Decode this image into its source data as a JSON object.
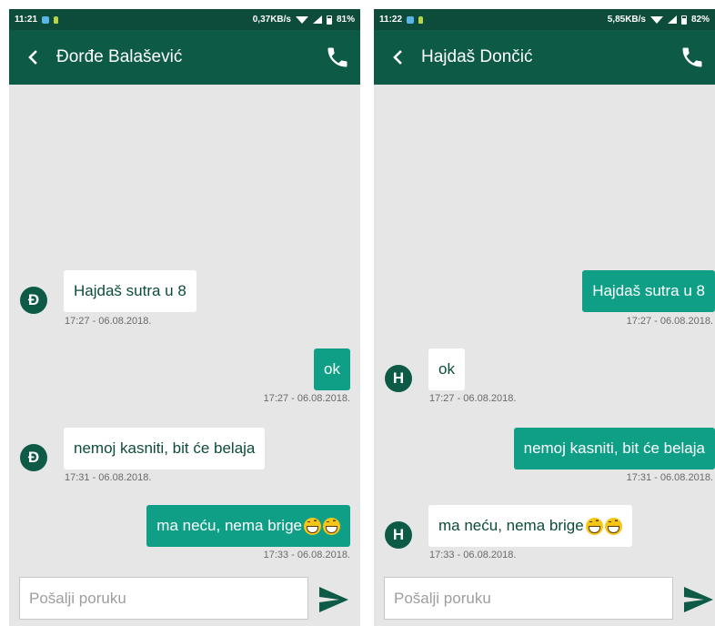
{
  "left_phone": {
    "status": {
      "time": "11:21",
      "net": "0,37KB/s",
      "battery": "81%"
    },
    "contact": {
      "name": "Đorđe Balašević",
      "initial": "Đ"
    },
    "messages": [
      {
        "dir": "in",
        "text": "Hajdaš sutra u 8",
        "emoji": 0,
        "time": "17:27 - 06.08.2018."
      },
      {
        "dir": "out",
        "text": "ok",
        "emoji": 0,
        "time": "17:27 - 06.08.2018."
      },
      {
        "dir": "in",
        "text": "nemoj kasniti, bit će belaja",
        "emoji": 0,
        "time": "17:31 - 06.08.2018."
      },
      {
        "dir": "out",
        "text": "ma neću, nema brige ",
        "emoji": 2,
        "time": "17:33 - 06.08.2018."
      }
    ],
    "composer": {
      "placeholder": "Pošalji poruku"
    }
  },
  "right_phone": {
    "status": {
      "time": "11:22",
      "net": "5,85KB/s",
      "battery": "82%"
    },
    "contact": {
      "name": "Hajdaš Dončić",
      "initial": "H"
    },
    "messages": [
      {
        "dir": "out",
        "text": "Hajdaš sutra u 8",
        "emoji": 0,
        "time": "17:27 - 06.08.2018."
      },
      {
        "dir": "in",
        "text": "ok",
        "emoji": 0,
        "time": "17:27 - 06.08.2018."
      },
      {
        "dir": "out",
        "text": "nemoj kasniti, bit će belaja",
        "emoji": 0,
        "time": "17:31 - 06.08.2018."
      },
      {
        "dir": "in",
        "text": "ma neću, nema brige ",
        "emoji": 2,
        "time": "17:33 - 06.08.2018."
      }
    ],
    "composer": {
      "placeholder": "Pošalji poruku"
    }
  },
  "icons": {
    "back": "arrow-left-icon",
    "call": "phone-icon",
    "send": "send-arrow-icon",
    "emoji": "grinning-face-with-tears-icon"
  },
  "colors": {
    "status_bar": "#0d4c3b",
    "app_bar": "#0d5b46",
    "outgoing_bubble": "#0f9f86",
    "incoming_bubble": "#ffffff",
    "chat_background": "#e6e6e6",
    "avatar": "#0d5b46",
    "send_icon": "#0d5b46"
  }
}
